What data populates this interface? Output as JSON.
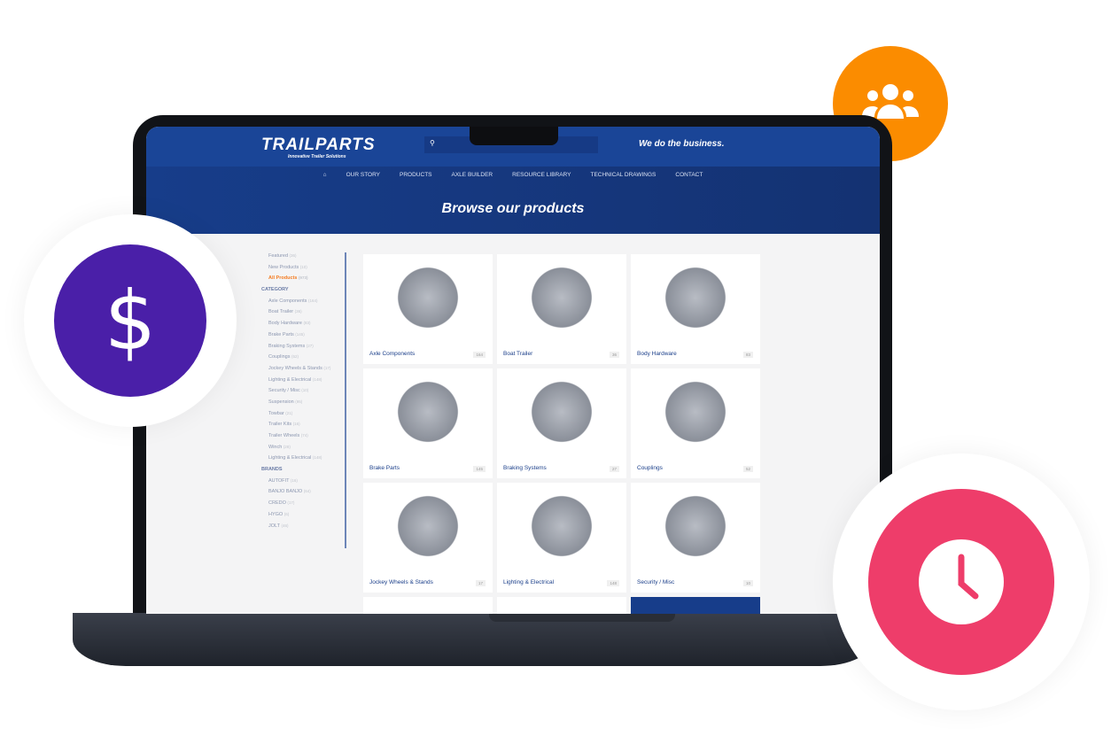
{
  "header": {
    "logo": "TRAILPARTS",
    "tagline": "Innovative Trailer Solutions",
    "slogan": "We do the business.",
    "search_placeholder": ""
  },
  "nav": [
    "OUR STORY",
    "PRODUCTS",
    "AXLE BUILDER",
    "RESOURCE LIBRARY",
    "TECHNICAL DRAWINGS",
    "CONTACT"
  ],
  "page_title": "Browse our products",
  "sidebar": {
    "top": [
      {
        "label": "Featured",
        "count": "(36)"
      },
      {
        "label": "New Products",
        "count": "(10)"
      },
      {
        "label": "All Products",
        "count": "(973)"
      }
    ],
    "category_heading": "CATEGORY",
    "categories": [
      {
        "label": "Axle Components",
        "count": "(164)"
      },
      {
        "label": "Boat Trailer",
        "count": "(36)"
      },
      {
        "label": "Body Hardware",
        "count": "(83)"
      },
      {
        "label": "Brake Parts",
        "count": "(145)"
      },
      {
        "label": "Braking Systems",
        "count": "(27)"
      },
      {
        "label": "Couplings",
        "count": "(52)"
      },
      {
        "label": "Jockey Wheels & Stands",
        "count": "(17)"
      },
      {
        "label": "Lighting & Electrical",
        "count": "(148)"
      },
      {
        "label": "Security / Misc",
        "count": "(10)"
      },
      {
        "label": "Suspension",
        "count": "(95)"
      },
      {
        "label": "Towbar",
        "count": "(21)"
      },
      {
        "label": "Trailer Kits",
        "count": "(16)"
      },
      {
        "label": "Trailer Wheels",
        "count": "(74)"
      },
      {
        "label": "Winch",
        "count": "(28)"
      },
      {
        "label": "Lighting & Electrical",
        "count": "(148)"
      }
    ],
    "brands_heading": "BRANDS",
    "brands": [
      {
        "label": "AUTOFIT",
        "count": "(16)"
      },
      {
        "label": "BANJO BANJO",
        "count": "(64)"
      },
      {
        "label": "CREDO",
        "count": "(17)"
      },
      {
        "label": "HYGO",
        "count": "(6)"
      },
      {
        "label": "JOLT",
        "count": "(46)"
      }
    ]
  },
  "products": [
    {
      "label": "Axle Components",
      "count": "164"
    },
    {
      "label": "Boat Trailer",
      "count": "36"
    },
    {
      "label": "Body Hardware",
      "count": "83"
    },
    {
      "label": "Brake Parts",
      "count": "145"
    },
    {
      "label": "Braking Systems",
      "count": "27"
    },
    {
      "label": "Couplings",
      "count": "52"
    },
    {
      "label": "Jockey Wheels & Stands",
      "count": "17"
    },
    {
      "label": "Lighting & Electrical",
      "count": "148"
    },
    {
      "label": "Security / Misc",
      "count": "10"
    }
  ],
  "colors": {
    "brand_blue": "#1a4597",
    "accent_orange": "#f47b20",
    "badge_orange": "#fb8c00",
    "badge_purple": "#4a1fa8",
    "badge_pink": "#ee3d6a"
  },
  "icons": {
    "badge1": "users-icon",
    "badge2": "dollar-icon",
    "badge3": "clock-icon"
  }
}
